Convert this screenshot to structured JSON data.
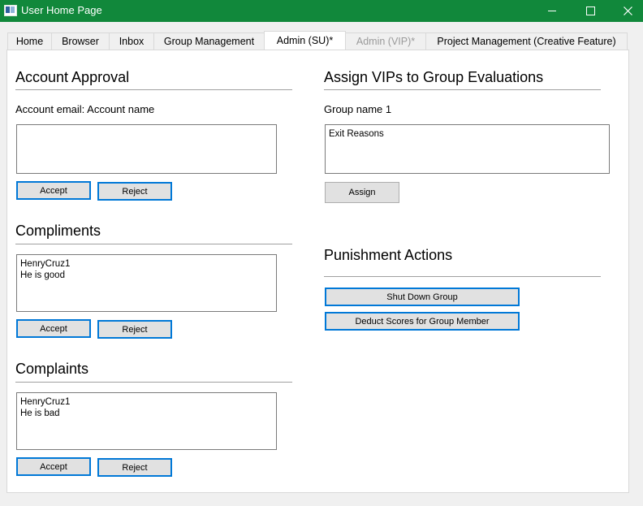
{
  "window": {
    "title": "User Home Page"
  },
  "tabs": [
    {
      "label": "Home"
    },
    {
      "label": "Browser"
    },
    {
      "label": "Inbox"
    },
    {
      "label": "Group Management"
    },
    {
      "label": "Admin (SU)*",
      "state": "active"
    },
    {
      "label": "Admin (VIP)*",
      "state": "disabled"
    },
    {
      "label": "Project Management (Creative Feature)"
    }
  ],
  "account_approval": {
    "title": "Account Approval",
    "email_label": "Account email: Account name",
    "textbox_value": "",
    "accept_label": "Accept",
    "reject_label": "Reject"
  },
  "compliments": {
    "title": "Compliments",
    "textbox_value": "HenryCruz1\nHe is good",
    "accept_label": "Accept",
    "reject_label": "Reject"
  },
  "complaints": {
    "title": "Complaints",
    "textbox_value": "HenryCruz1\nHe is bad",
    "accept_label": "Accept",
    "reject_label": "Reject"
  },
  "assign_vips": {
    "title": "Assign VIPs to Group Evaluations",
    "group_label": "Group name 1",
    "textbox_value": "Exit Reasons",
    "assign_label": "Assign"
  },
  "punishment": {
    "title": "Punishment Actions",
    "shutdown_label": "Shut Down Group",
    "deduct_label": "Deduct Scores for Group Member"
  },
  "colors": {
    "titlebar": "#11883b",
    "focus_border": "#0078d7"
  }
}
